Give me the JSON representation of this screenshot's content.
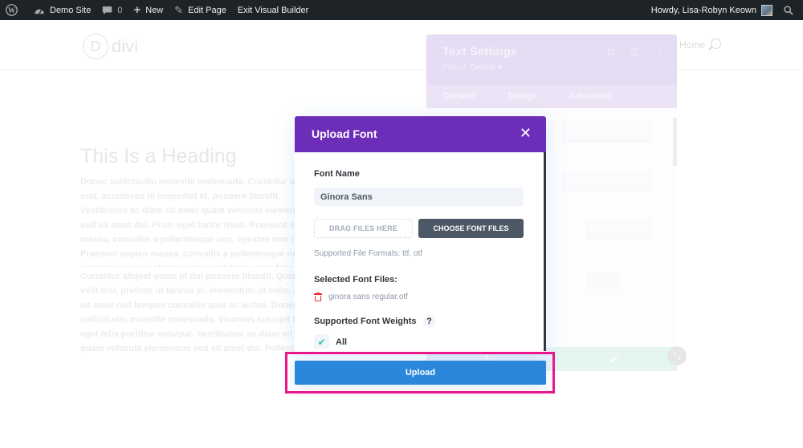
{
  "adminbar": {
    "site_name": "Demo Site",
    "comments_count": "0",
    "new_label": "New",
    "edit_page_label": "Edit Page",
    "exit_builder_label": "Exit Visual Builder",
    "greeting": "Howdy, Lisa-Robyn Keown"
  },
  "site": {
    "logo_letter": "D",
    "logo_text": "divi",
    "nav_home": "Home"
  },
  "content": {
    "heading": "This Is a Heading",
    "paragraph1": "Donec sollicitudin molestie malesuada. Curabitur arcu erat, accumsan id imperdiet et, posuere blandit. Vestibulum ac diam sit amet quam vehicula elementum sed sit amet dui. Proin eget tortor risus. Praesent sapien massa, convallis a pellentesque nec, egestas non nisi. Praesent sapien massa, convallis a pellentesque nec, egestas non nisi. Vivamus suscipit tortor eget felis porttitor volutpat.",
    "paragraph2": "Curabitur aliquet quam id dui posuere blandit. Quisque velit nisi, pretium ut lacinia in, elementum id enim. Donec sit amet nisl tempus convallis quis ac lectus. Donec sollicitudin molestie malesuada. Vivamus suscipit tortor eget felis porttitor volutpat. Vestibulum ac diam sit amet quam vehicula elementum sed sit amet dui. Pellentesque in ipsum id orci porta dapibus. Vivamus suscipit tortor eget felis porttitor volutpat."
  },
  "settings_panel": {
    "title": "Text Settings",
    "preset": "Preset: Default ▾",
    "tabs": [
      "Content",
      "Design",
      "Advanced"
    ]
  },
  "modal": {
    "title": "Upload Font",
    "font_name_label": "Font Name",
    "font_name_value": "Ginora Sans",
    "drag_label": "DRAG FILES HERE",
    "choose_label": "CHOOSE FONT FILES",
    "supported_formats": "Supported File Formats: ttf, otf",
    "selected_files_label": "Selected Font Files:",
    "selected_files": [
      "ginora sans regular.otf"
    ],
    "weights_label": "Supported Font Weights",
    "help_glyph": "?",
    "weights_option": "All",
    "weights_checked": true,
    "upload_label": "Upload"
  },
  "colors": {
    "modal_header": "#6c2eb9",
    "upload_button": "#2b87da",
    "highlight": "#e9168c",
    "choose_button": "#4c5866",
    "trash": "#ef2d33",
    "check": "#29c4a9"
  }
}
